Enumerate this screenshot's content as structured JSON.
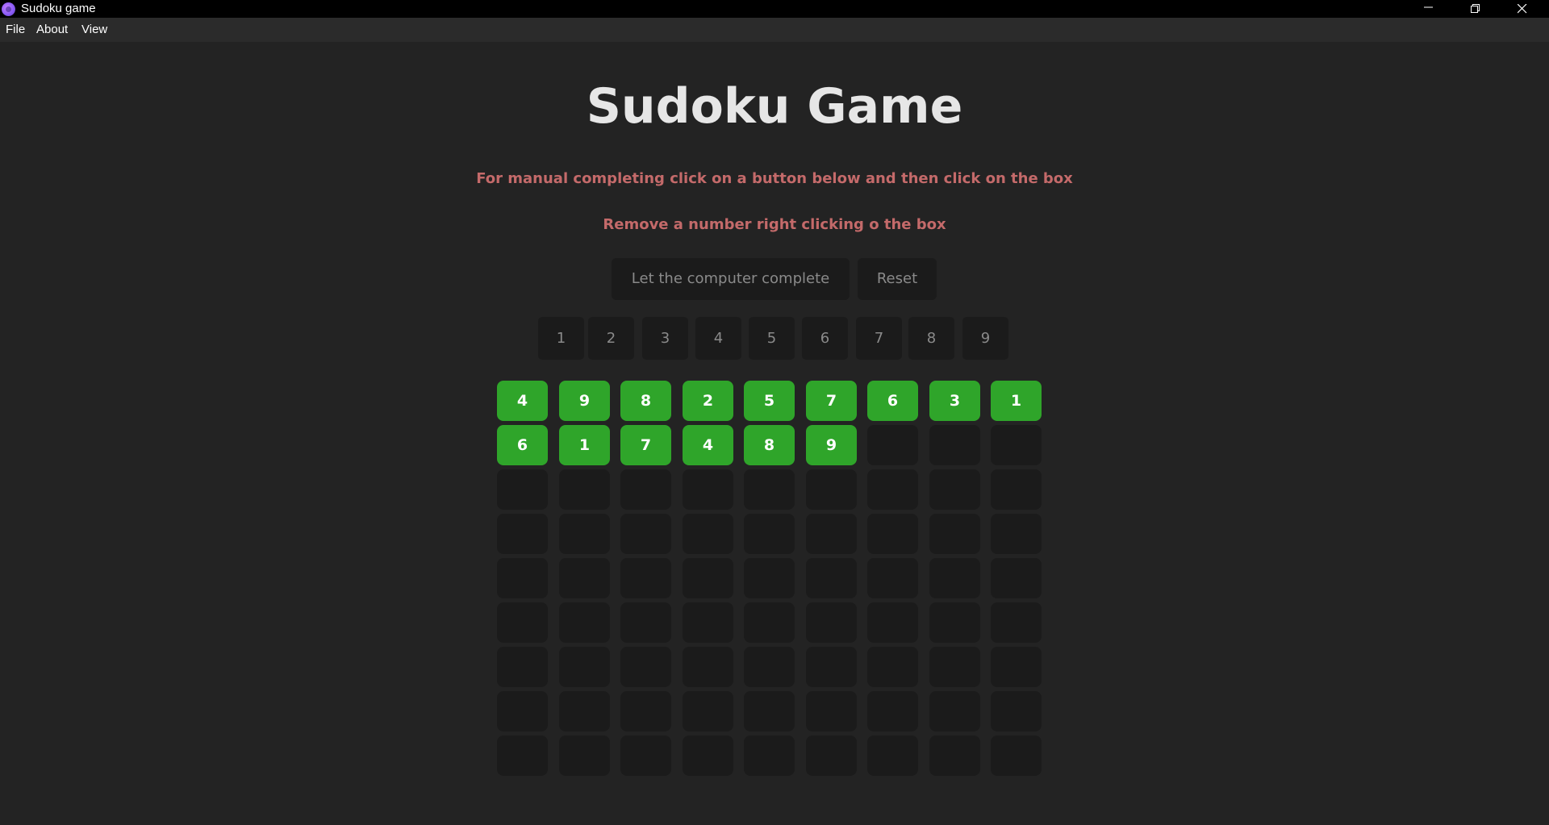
{
  "window": {
    "title": "Sudoku game"
  },
  "menu": {
    "file": "File",
    "about": "About",
    "view": "View"
  },
  "page": {
    "title": "Sudoku Game",
    "instruction_1": "For manual completing click on a button below and then click on the box",
    "instruction_2": "Remove a number right clicking o the box"
  },
  "actions": {
    "complete_label": "Let the computer complete",
    "reset_label": "Reset"
  },
  "number_buttons": [
    "1",
    "2",
    "3",
    "4",
    "5",
    "6",
    "7",
    "8",
    "9"
  ],
  "grid": [
    [
      "4",
      "9",
      "8",
      "2",
      "5",
      "7",
      "6",
      "3",
      "1"
    ],
    [
      "6",
      "1",
      "7",
      "4",
      "8",
      "9",
      "",
      "",
      ""
    ],
    [
      "",
      "",
      "",
      "",
      "",
      "",
      "",
      "",
      ""
    ],
    [
      "",
      "",
      "",
      "",
      "",
      "",
      "",
      "",
      ""
    ],
    [
      "",
      "",
      "",
      "",
      "",
      "",
      "",
      "",
      ""
    ],
    [
      "",
      "",
      "",
      "",
      "",
      "",
      "",
      "",
      ""
    ],
    [
      "",
      "",
      "",
      "",
      "",
      "",
      "",
      "",
      ""
    ],
    [
      "",
      "",
      "",
      "",
      "",
      "",
      "",
      "",
      ""
    ],
    [
      "",
      "",
      "",
      "",
      "",
      "",
      "",
      "",
      ""
    ]
  ],
  "colors": {
    "background": "#232323",
    "filled_cell": "#2fa52a",
    "empty_cell": "#1b1b1b",
    "instruction_text": "#c46a6a",
    "title_text": "#e6e6e6"
  },
  "icons": {
    "app": "sudoku-app-icon",
    "minimize": "minimize-icon",
    "maximize": "restore-icon",
    "close": "close-icon"
  }
}
